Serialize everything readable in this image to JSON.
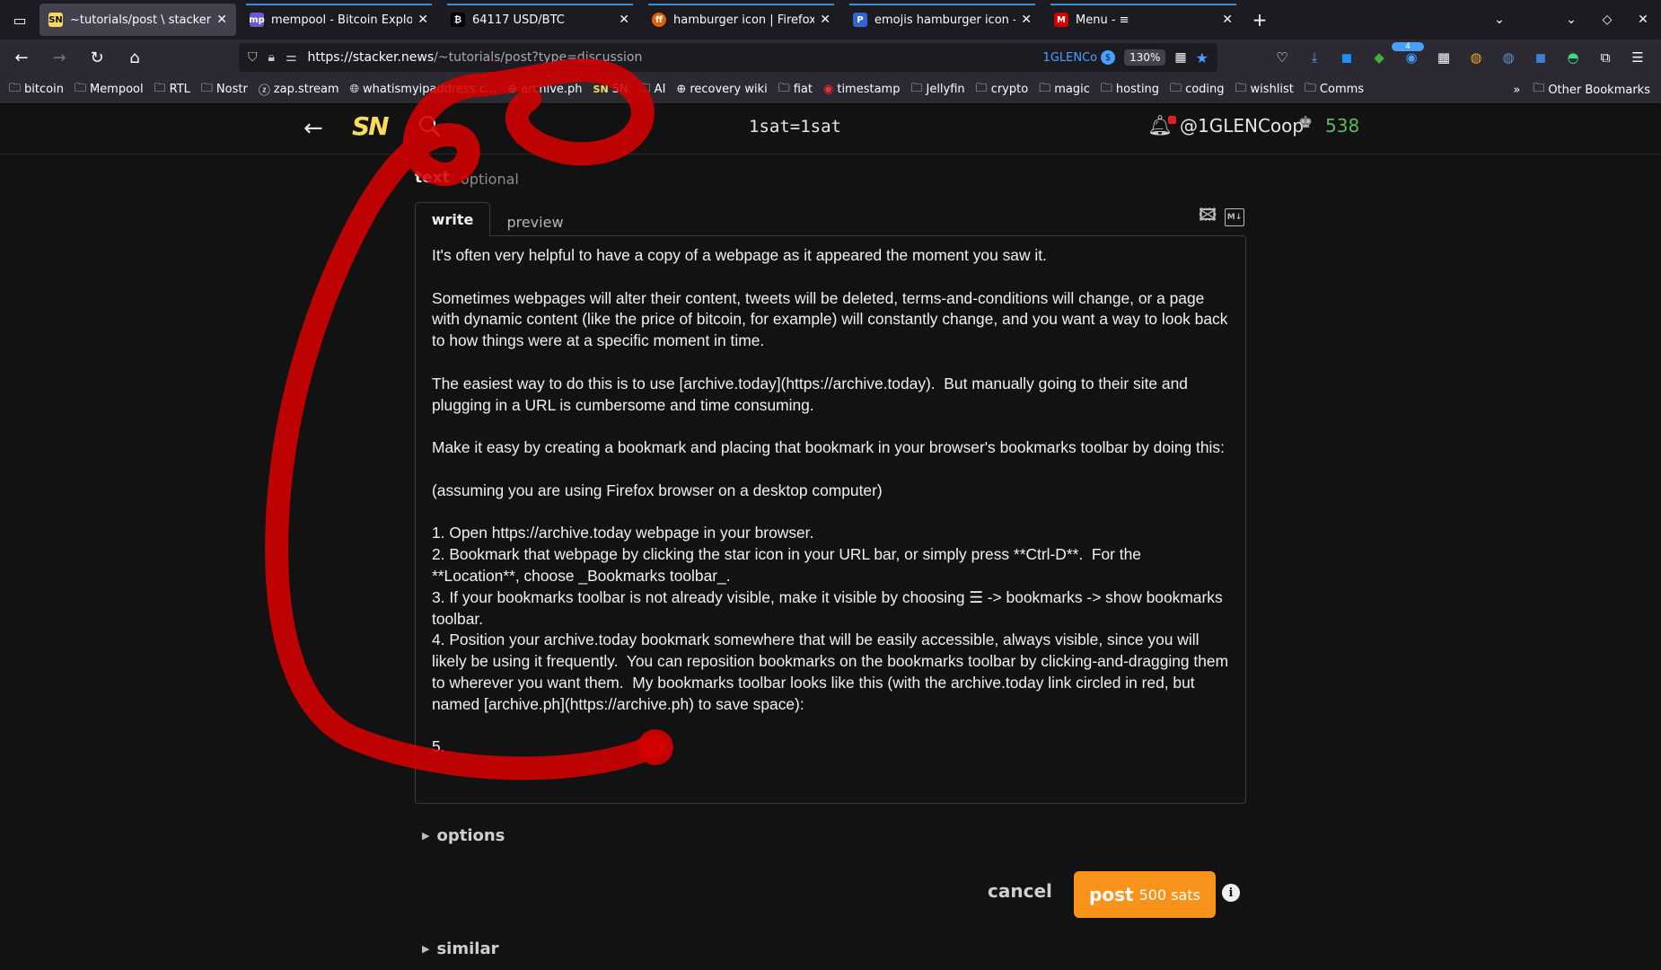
{
  "browser": {
    "tabs": [
      {
        "title": "~tutorials/post \\ stacker ne",
        "favicon": "SN",
        "active": true
      },
      {
        "title": "mempool - Bitcoin Explore",
        "favicon": "mp"
      },
      {
        "title": "64117 USD/BTC",
        "favicon": "₿"
      },
      {
        "title": "hamburger icon | Firefox S",
        "favicon": "ff"
      },
      {
        "title": "emojis hamburger icon - P",
        "favicon": "P"
      },
      {
        "title": "Menu - ≡",
        "favicon": "M"
      }
    ],
    "url_host": "https://stacker.news",
    "url_path": "/~tutorials/post?type=discussion",
    "container": "1GLENCo",
    "zoom": "130%",
    "ext_badge": "4",
    "bookmarks": [
      {
        "label": "bitcoin",
        "icon": "folder-icon"
      },
      {
        "label": "Mempool",
        "icon": "folder-icon"
      },
      {
        "label": "RTL",
        "icon": "folder-icon"
      },
      {
        "label": "Nostr",
        "icon": "folder-icon"
      },
      {
        "label": "zap.stream",
        "icon": "zap-icon"
      },
      {
        "label": "whatismyipaddress.c...",
        "icon": "globe-icon"
      },
      {
        "label": "archive.ph",
        "icon": "globe-icon"
      },
      {
        "label": "SN",
        "icon": "sn-icon"
      },
      {
        "label": "AI",
        "icon": "folder-icon"
      },
      {
        "label": "recovery wiki",
        "icon": "globe-icon"
      },
      {
        "label": "fiat",
        "icon": "folder-icon"
      },
      {
        "label": "timestamp",
        "icon": "clock-icon"
      },
      {
        "label": "Jellyfin",
        "icon": "folder-icon"
      },
      {
        "label": "crypto",
        "icon": "folder-icon"
      },
      {
        "label": "magic",
        "icon": "folder-icon"
      },
      {
        "label": "hosting",
        "icon": "folder-icon"
      },
      {
        "label": "coding",
        "icon": "folder-icon"
      },
      {
        "label": "wishlist",
        "icon": "folder-icon"
      },
      {
        "label": "Comms",
        "icon": "folder-icon"
      }
    ],
    "other_bookmarks": "Other Bookmarks"
  },
  "site": {
    "logo": "SN",
    "center": "1sat=1sat",
    "user": "@1GLENCoop",
    "sats": "538"
  },
  "form": {
    "label": "text",
    "label_hint": "optional",
    "tab_write": "write",
    "tab_preview": "preview",
    "body": "It's often very helpful to have a copy of a webpage as it appeared the moment you saw it.\n\nSometimes webpages will alter their content, tweets will be deleted, terms-and-conditions will change, or a page with dynamic content (like the price of bitcoin, for example) will constantly change, and you want a way to look back to how things were at a specific moment in time.\n\nThe easiest way to do this is to use [archive.today](https://archive.today).  But manually going to their site and plugging in a URL is cumbersome and time consuming.\n\nMake it easy by creating a bookmark and placing that bookmark in your browser's bookmarks toolbar by doing this:\n\n(assuming you are using Firefox browser on a desktop computer)\n\n1. Open https://archive.today webpage in your browser.\n2. Bookmark that webpage by clicking the star icon in your URL bar, or simply press **Ctrl-D**.  For the **Location**, choose _Bookmarks toolbar_.\n3. If your bookmarks toolbar is not already visible, make it visible by choosing ☰ -> bookmarks -> show bookmarks toolbar.\n4. Position your archive.today bookmark somewhere that will be easily accessible, always visible, since you will likely be using it frequently.  You can reposition bookmarks on the bookmarks toolbar by clicking-and-dragging them to wherever you want them.  My bookmarks toolbar looks like this (with the archive.today link circled in red, but named [archive.ph](https://archive.ph) to save space):\n\n5. ",
    "options": "options",
    "cancel": "cancel",
    "post": "post",
    "post_cost": "500 sats",
    "similar": "similar"
  },
  "colors": {
    "accent": "#f7931a",
    "logo": "#fada5e",
    "sats": "#5cb85c",
    "scribble": "#d40000"
  }
}
